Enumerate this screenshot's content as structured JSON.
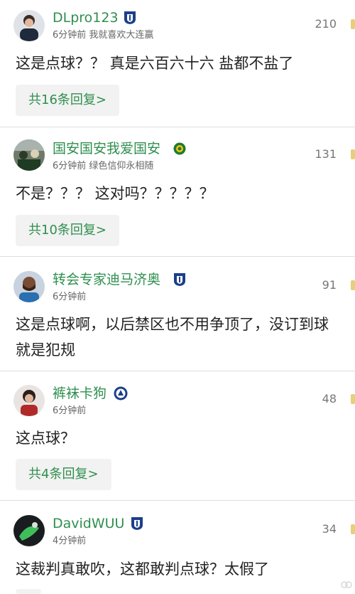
{
  "comments": [
    {
      "username": "DLpro123",
      "time": "6分钟前",
      "bio": "我就喜欢大连赢",
      "likes": "210",
      "text": "这是点球？？ 真是六百六十六 盐都不盐了",
      "reply": "共16条回复>",
      "badge": "dalian-team-badge"
    },
    {
      "username": "国安国安我爱国安",
      "time": "6分钟前",
      "bio": "绿色信仰永相随",
      "likes": "131",
      "text": "不是？？？ 这对吗？？？？？",
      "reply": "共10条回复>",
      "badge": "guoan-team-badge"
    },
    {
      "username": "转会专家迪马济奥",
      "time": "6分钟前",
      "bio": "",
      "likes": "91",
      "text_line1": "这是点球啊，以后禁区也不用争顶了，没订到球",
      "text_line2": "就是犯规",
      "badge": "dalian-team-badge"
    },
    {
      "username": "裤袜卡狗",
      "time": "6分钟前",
      "bio": "",
      "likes": "48",
      "text": "这点球？",
      "reply": "共4条回复>",
      "badge": "round-team-badge"
    },
    {
      "username": "DavidWUU",
      "time": "4分钟前",
      "bio": "",
      "likes": "34",
      "text": "这裁判真敢吹，这都敢判点球？太假了",
      "badge": "dalian-team-badge"
    }
  ],
  "colors": {
    "username": "#2f8f4f",
    "reply_bg": "#f2f2f2",
    "like_bar": "#e6cf7a"
  }
}
